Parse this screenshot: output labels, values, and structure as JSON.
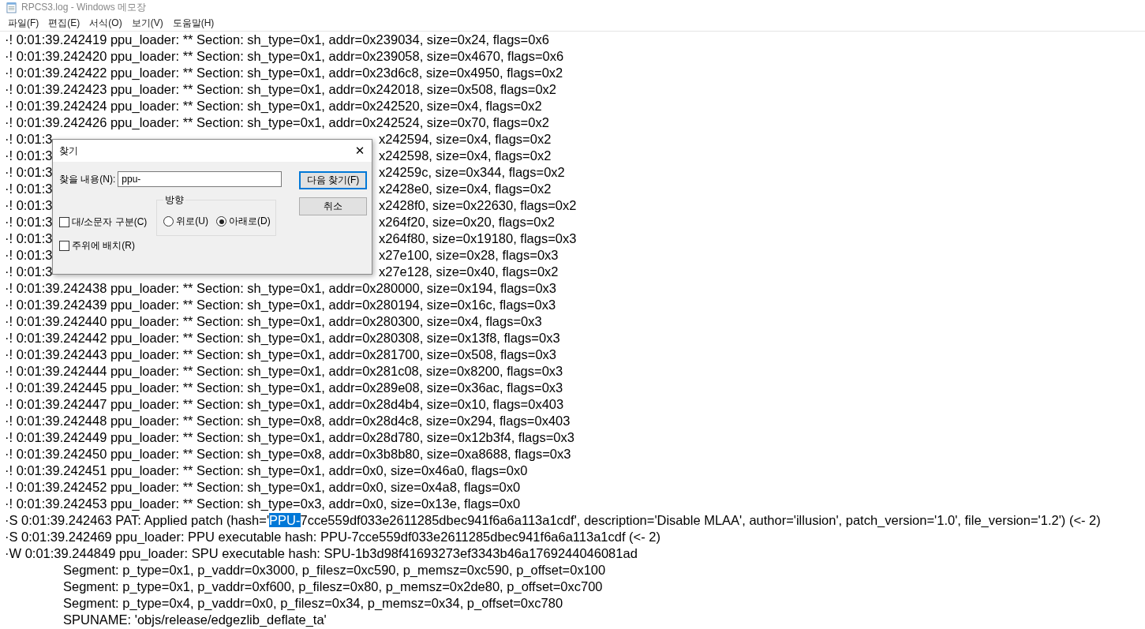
{
  "window": {
    "title": "RPCS3.log - Windows 메모장"
  },
  "menu": [
    "파일(F)",
    "편집(E)",
    "서식(O)",
    "보기(V)",
    "도움말(H)"
  ],
  "lines": [
    {
      "kind": "entry",
      "text": "·! 0:01:39.242419 ppu_loader: ** Section: sh_type=0x1, addr=0x239034, size=0x24, flags=0x6"
    },
    {
      "kind": "entry",
      "text": "·! 0:01:39.242420 ppu_loader: ** Section: sh_type=0x1, addr=0x239058, size=0x4670, flags=0x6"
    },
    {
      "kind": "entry",
      "text": "·! 0:01:39.242422 ppu_loader: ** Section: sh_type=0x1, addr=0x23d6c8, size=0x4950, flags=0x2"
    },
    {
      "kind": "entry",
      "text": "·! 0:01:39.242423 ppu_loader: ** Section: sh_type=0x1, addr=0x242018, size=0x508, flags=0x2"
    },
    {
      "kind": "entry",
      "text": "·! 0:01:39.242424 ppu_loader: ** Section: sh_type=0x1, addr=0x242520, size=0x4, flags=0x2"
    },
    {
      "kind": "entry",
      "text": "·! 0:01:39.242426 ppu_loader: ** Section: sh_type=0x1, addr=0x242524, size=0x70, flags=0x2"
    },
    {
      "kind": "split",
      "left": "·! 0:01:3",
      "right": "x242594, size=0x4, flags=0x2"
    },
    {
      "kind": "split",
      "left": "·! 0:01:3",
      "right": "x242598, size=0x4, flags=0x2"
    },
    {
      "kind": "split",
      "left": "·! 0:01:3",
      "right": "x24259c, size=0x344, flags=0x2"
    },
    {
      "kind": "split",
      "left": "·! 0:01:3",
      "right": "x2428e0, size=0x4, flags=0x2"
    },
    {
      "kind": "split",
      "left": "·! 0:01:3",
      "right": "x2428f0, size=0x22630, flags=0x2"
    },
    {
      "kind": "split",
      "left": "·! 0:01:3",
      "right": "x264f20, size=0x20, flags=0x2"
    },
    {
      "kind": "split",
      "left": "·! 0:01:3",
      "right": "x264f80, size=0x19180, flags=0x3"
    },
    {
      "kind": "split",
      "left": "·! 0:01:3",
      "right": "x27e100, size=0x28, flags=0x3"
    },
    {
      "kind": "split",
      "left": "·! 0:01:3",
      "right": "x27e128, size=0x40, flags=0x2"
    },
    {
      "kind": "entry",
      "text": "·! 0:01:39.242438 ppu_loader: ** Section: sh_type=0x1, addr=0x280000, size=0x194, flags=0x3"
    },
    {
      "kind": "entry",
      "text": "·! 0:01:39.242439 ppu_loader: ** Section: sh_type=0x1, addr=0x280194, size=0x16c, flags=0x3"
    },
    {
      "kind": "entry",
      "text": "·! 0:01:39.242440 ppu_loader: ** Section: sh_type=0x1, addr=0x280300, size=0x4, flags=0x3"
    },
    {
      "kind": "entry",
      "text": "·! 0:01:39.242442 ppu_loader: ** Section: sh_type=0x1, addr=0x280308, size=0x13f8, flags=0x3"
    },
    {
      "kind": "entry",
      "text": "·! 0:01:39.242443 ppu_loader: ** Section: sh_type=0x1, addr=0x281700, size=0x508, flags=0x3"
    },
    {
      "kind": "entry",
      "text": "·! 0:01:39.242444 ppu_loader: ** Section: sh_type=0x1, addr=0x281c08, size=0x8200, flags=0x3"
    },
    {
      "kind": "entry",
      "text": "·! 0:01:39.242445 ppu_loader: ** Section: sh_type=0x1, addr=0x289e08, size=0x36ac, flags=0x3"
    },
    {
      "kind": "entry",
      "text": "·! 0:01:39.242447 ppu_loader: ** Section: sh_type=0x1, addr=0x28d4b4, size=0x10, flags=0x403"
    },
    {
      "kind": "entry",
      "text": "·! 0:01:39.242448 ppu_loader: ** Section: sh_type=0x8, addr=0x28d4c8, size=0x294, flags=0x403"
    },
    {
      "kind": "entry",
      "text": "·! 0:01:39.242449 ppu_loader: ** Section: sh_type=0x1, addr=0x28d780, size=0x12b3f4, flags=0x3"
    },
    {
      "kind": "entry",
      "text": "·! 0:01:39.242450 ppu_loader: ** Section: sh_type=0x8, addr=0x3b8b80, size=0xa8688, flags=0x3"
    },
    {
      "kind": "entry",
      "text": "·! 0:01:39.242451 ppu_loader: ** Section: sh_type=0x1, addr=0x0, size=0x46a0, flags=0x0"
    },
    {
      "kind": "entry",
      "text": "·! 0:01:39.242452 ppu_loader: ** Section: sh_type=0x1, addr=0x0, size=0x4a8, flags=0x0"
    },
    {
      "kind": "entry",
      "text": "·! 0:01:39.242453 ppu_loader: ** Section: sh_type=0x3, addr=0x0, size=0x13e, flags=0x0"
    },
    {
      "kind": "selection",
      "before": "·S 0:01:39.242463 PAT: Applied patch (hash='",
      "selected": "PPU-",
      "after": "7cce559df033e2611285dbec941f6a6a113a1cdf', description='Disable MLAA', author='illusion', patch_version='1.0', file_version='1.2') (<- 2)"
    },
    {
      "kind": "entry",
      "text": "·S 0:01:39.242469 ppu_loader: PPU executable hash: PPU-7cce559df033e2611285dbec941f6a6a113a1cdf (<- 2)"
    },
    {
      "kind": "entry",
      "text": "·W 0:01:39.244849 ppu_loader: SPU executable hash: SPU-1b3d98f41693273ef3343b46a1769244046081ad"
    },
    {
      "kind": "continuation",
      "text": "Segment: p_type=0x1, p_vaddr=0x3000, p_filesz=0xc590, p_memsz=0xc590, p_offset=0x100"
    },
    {
      "kind": "continuation",
      "text": "Segment: p_type=0x1, p_vaddr=0xf600, p_filesz=0x80, p_memsz=0x2de80, p_offset=0xc700"
    },
    {
      "kind": "continuation",
      "text": "Segment: p_type=0x4, p_vaddr=0x0, p_filesz=0x34, p_memsz=0x34, p_offset=0xc780"
    },
    {
      "kind": "continuation",
      "text": "SPUNAME: 'objs/release/edgezlib_deflate_ta'"
    }
  ],
  "find_dialog": {
    "title": "찾기",
    "close": "✕",
    "find_label": "찾을 내용(N):",
    "find_value": "ppu-",
    "find_next": "다음 찾기(F)",
    "cancel": "취소",
    "match_case": {
      "label": "대/소문자 구분(C)",
      "checked": false
    },
    "wrap_around": {
      "label": "주위에 배치(R)",
      "checked": false
    },
    "direction": {
      "title": "방향",
      "options": [
        {
          "label": "위로(U)",
          "selected": false
        },
        {
          "label": "아래로(D)",
          "selected": true
        }
      ]
    }
  }
}
